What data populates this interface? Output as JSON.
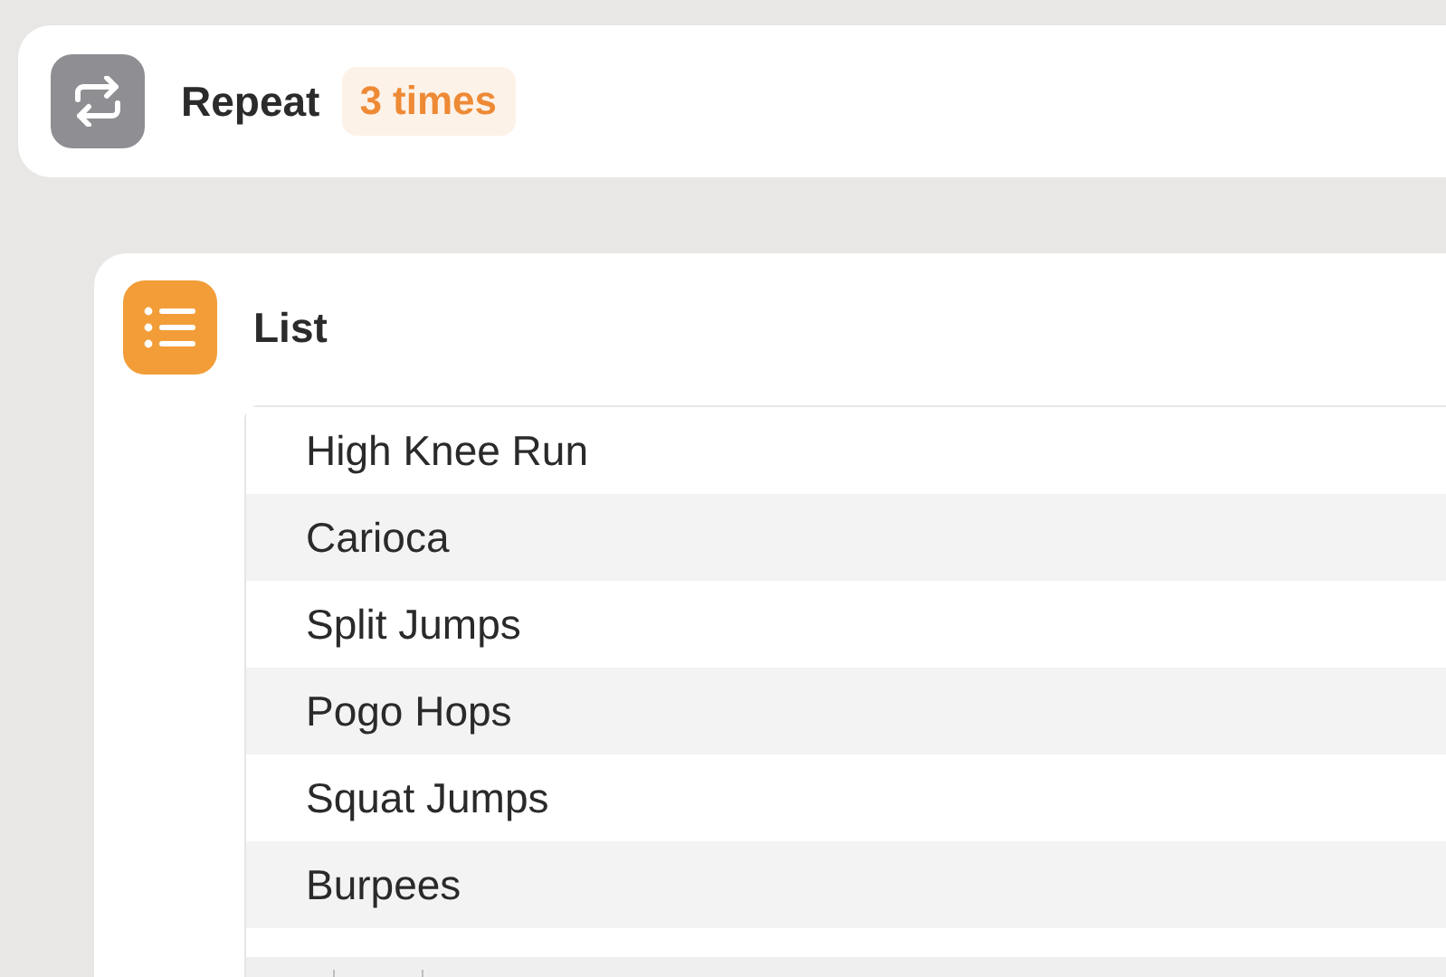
{
  "repeat_action": {
    "title": "Repeat",
    "count": "3 times"
  },
  "list_action": {
    "title": "List",
    "items": [
      {
        "text": "High Knee Run"
      },
      {
        "text": "Carioca"
      },
      {
        "text": "Split Jumps"
      },
      {
        "text": "Pogo Hops"
      },
      {
        "text": "Squat Jumps"
      },
      {
        "text": "Burpees"
      }
    ]
  }
}
